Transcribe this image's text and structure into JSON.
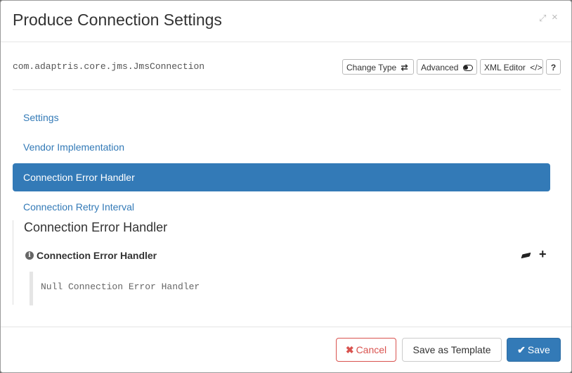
{
  "modal": {
    "title": "Produce Connection Settings",
    "expand_icon": "expand-icon",
    "close_icon": "close-icon"
  },
  "toolbar": {
    "class_name": "com.adaptris.core.jms.JmsConnection",
    "change_type_label": "Change Type",
    "change_type_icon": "⇄",
    "advanced_label": "Advanced",
    "xml_editor_label": "XML Editor",
    "xml_editor_icon": "</>",
    "help_label": "?"
  },
  "nav": {
    "items": [
      {
        "label": "Settings",
        "active": false
      },
      {
        "label": "Vendor Implementation",
        "active": false
      },
      {
        "label": "Connection Error Handler",
        "active": true
      },
      {
        "label": "Connection Retry Interval",
        "active": false
      }
    ]
  },
  "section": {
    "title": "Connection Error Handler",
    "field_label": "Connection Error Handler",
    "field_value": "Null Connection Error Handler",
    "info_icon": "ℹ",
    "eraser_icon": "eraser-icon",
    "plus_icon": "+"
  },
  "footer": {
    "cancel_label": "Cancel",
    "cancel_icon": "✖",
    "template_label": "Save as Template",
    "save_label": "Save",
    "save_icon": "✔"
  },
  "colors": {
    "primary": "#337ab7",
    "danger": "#d9534f"
  }
}
